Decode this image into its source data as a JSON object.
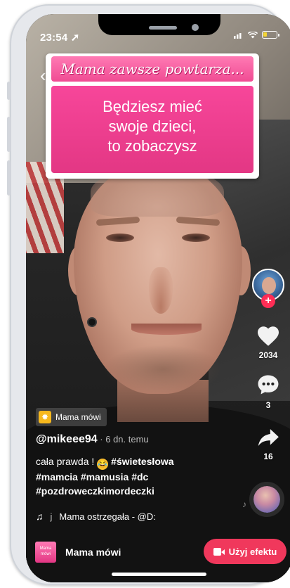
{
  "status_bar": {
    "time": "23:54 ➚"
  },
  "effect_card": {
    "title": "Mama zawsze powtarza...",
    "body_lines": [
      "Będziesz mieć",
      "swoje dzieci,",
      "to zobaczysz"
    ]
  },
  "rail": {
    "likes": "2034",
    "comments": "3",
    "shares": "16",
    "follow_symbol": "+"
  },
  "effect_tag": {
    "label": "Mama mówi"
  },
  "post": {
    "author": "@mikeee94",
    "time": " · 6 dn. temu",
    "caption_text": "cała prawda ! ",
    "caption_emoji": "😂",
    "hashtags_line1": "#świetesłowa",
    "hashtags_line2": "#mamcia  #mamusia  #dc",
    "hashtags_line3": "#pozdroweczkimordeczki"
  },
  "music": {
    "separator": "j",
    "title": "Mama ostrzegała - @D:"
  },
  "bottom_bar": {
    "thumb_text": "Mama mówi",
    "title": "Mama mówi",
    "cta": "Użyj efektu"
  },
  "colors": {
    "accent": "#f0385c",
    "pink": "#f04c93"
  },
  "icons": [
    "back-chevron-icon",
    "heart-icon",
    "comment-icon",
    "share-icon",
    "music-note-icon",
    "camera-icon",
    "sparkle-icon"
  ]
}
